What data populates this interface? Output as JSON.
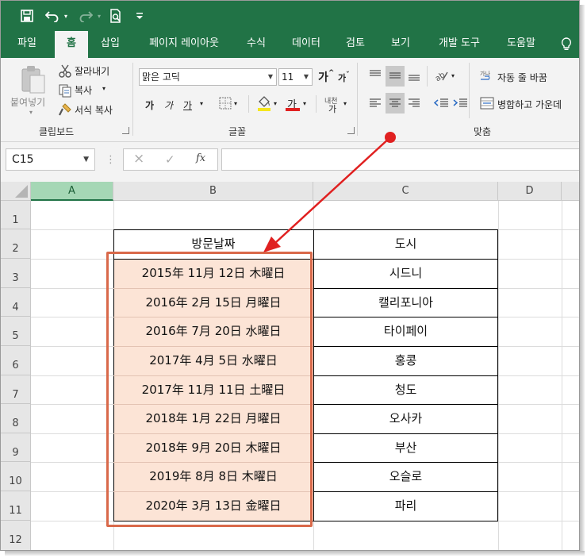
{
  "quick_access": {
    "save_icon": "save-icon",
    "undo_icon": "undo-icon",
    "redo_icon": "redo-icon",
    "print_preview_icon": "print-preview-icon",
    "customize_icon": "customize-qat-icon"
  },
  "tabs": [
    "파일",
    "홈",
    "삽입",
    "페이지 레이아웃",
    "수식",
    "데이터",
    "검토",
    "보기",
    "개발 도구",
    "도움말"
  ],
  "active_tab": "홈",
  "ribbon": {
    "clipboard": {
      "label": "클립보드",
      "paste": "붙여넣기",
      "cut": "잘라내기",
      "copy": "복사",
      "format_painter": "서식 복사"
    },
    "font": {
      "label": "글꼴",
      "font_name": "맑은 고딕",
      "font_size": "11",
      "grow": "가",
      "shrink": "가",
      "bold": "가",
      "italic": "가",
      "underline": "가",
      "font_color": "가",
      "phonetic": "내천",
      "fill_color": "#f5e61e",
      "text_color": "#e02020"
    },
    "alignment": {
      "label": "맞춤",
      "wrap_text": "자동 줄 바꿈",
      "merge_center": "병합하고 가운데"
    }
  },
  "formula_bar": {
    "name_box": "C15",
    "cancel": "×",
    "enter": "✓",
    "fx": "fx",
    "formula": ""
  },
  "columns": [
    "A",
    "B",
    "C",
    "D"
  ],
  "selected_column": "A",
  "rows": [
    "1",
    "2",
    "3",
    "4",
    "5",
    "6",
    "7",
    "8",
    "9",
    "10",
    "11",
    "12"
  ],
  "table": {
    "headers": [
      "방문날짜",
      "도시"
    ],
    "rows": [
      [
        "2015年 11月 12日 木曜日",
        "시드니"
      ],
      [
        "2016年 2月 15日 月曜日",
        "캘리포니아"
      ],
      [
        "2016年 7月 20日 水曜日",
        "타이페이"
      ],
      [
        "2017年 4月 5日 水曜日",
        "홍콩"
      ],
      [
        "2017年 11月 11日 土曜日",
        "청도"
      ],
      [
        "2018年 1月 22日 月曜日",
        "오사카"
      ],
      [
        "2018年 9月 20日 木曜日",
        "부산"
      ],
      [
        "2019年 8月 8日 木曜日",
        "오슬로"
      ],
      [
        "2020年 3月 13日 金曜日",
        "파리"
      ]
    ]
  },
  "colors": {
    "excel_green": "#217346",
    "highlight_fill": "#fce4d6",
    "highlight_border": "#d9694a",
    "arrow": "#e02020"
  }
}
